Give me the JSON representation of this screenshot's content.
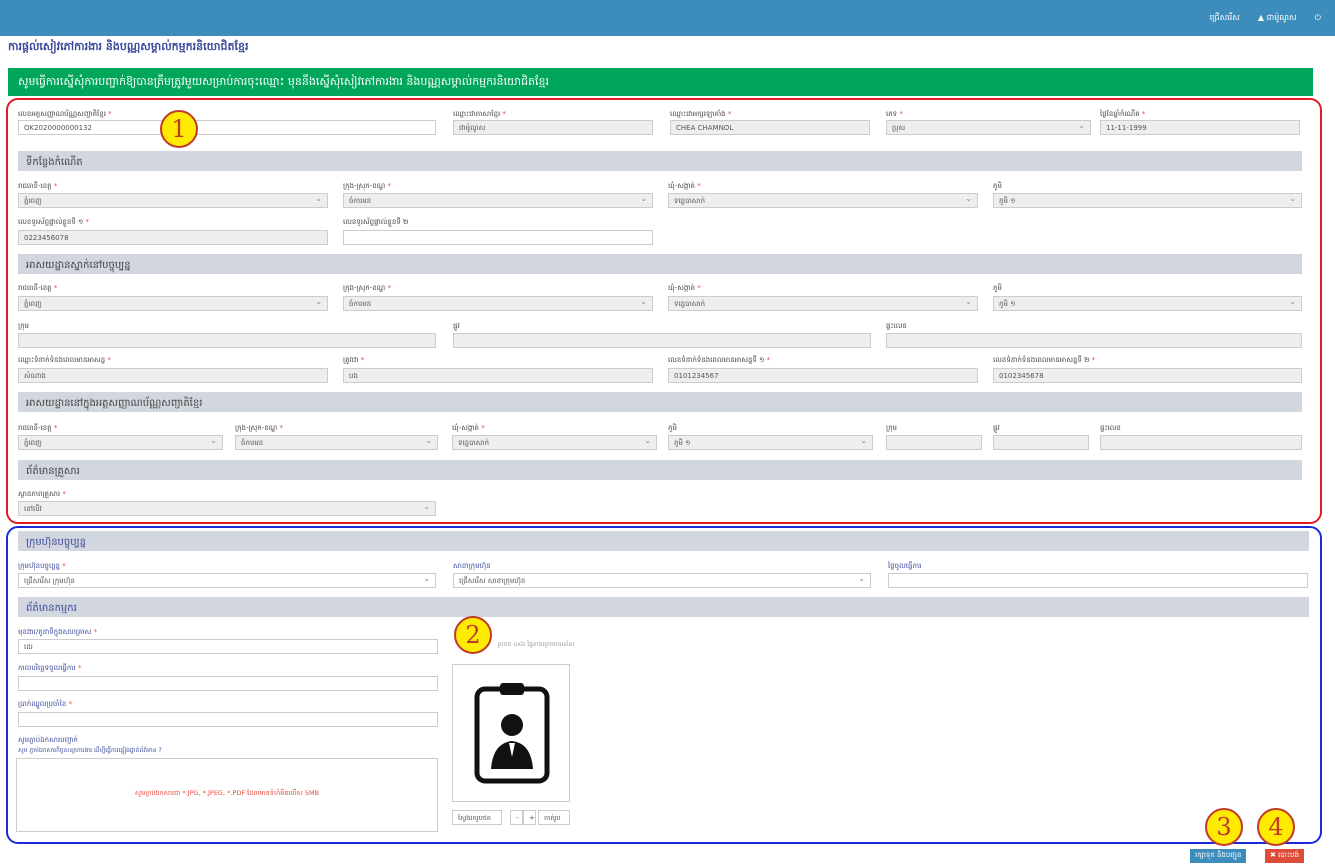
{
  "topbar": {
    "item1": "ជ្រើសរើស",
    "item2": "▲ ជាម៉ូណូស",
    "power": "⏻"
  },
  "page_title": "ការផ្ដល់សៀវភៅការងារ និងបណ្ណសម្គាល់កម្មករនិយោជិតខ្មែរ",
  "banner": "សូមធ្វើការស្នើសុំការបញ្ជាក់ឱ្យបានត្រឹមត្រូវមួយសម្រាប់ការចុះឈ្មោះ មុននឹងស្នើសុំសៀវភៅការងារ និងបណ្ណសម្គាល់កម្មករនិយោជិតខ្មែរ",
  "personal": {
    "id_label": "លេខអត្តសញ្ញាណប័ណ្ណសញ្ជាតិខ្មែរ",
    "id_value": "OK2020000000132",
    "name_kh_label": "ឈ្មោះជាភាសាខ្មែរ",
    "name_kh_value": "ជាម៉ូណូស",
    "name_en_label": "ឈ្មោះជាអក្សរឡាតាំង",
    "name_en_value": "CHEA CHAMNOL",
    "sex_label": "ភេទ",
    "sex_value": "ប្រុស",
    "dob_label": "ថ្ងៃខែឆ្នាំកំណើត",
    "dob_value": "11-11-1999"
  },
  "sections": {
    "birthplace": "ទីកន្លែងកំណើត",
    "current_address": "អាសយដ្ឋានស្នាក់នៅបច្ចុប្បន្ន",
    "id_address": "អាសយដ្ឋាននៅក្នុងអត្តសញ្ញាណប័ណ្ណសញ្ជាតិខ្មែរ",
    "family": "ព័ត៌មានគ្រួសារ",
    "employer": "ក្រុមហ៊ុនបច្ចុប្បន្ន",
    "worker_info": "ព័ត៌មានកម្មករ"
  },
  "labels": {
    "province": "រាជធានី-ខេត្ត",
    "district": "ក្រុង-ស្រុក-ខណ្ឌ",
    "commune": "ឃុំ-សង្កាត់",
    "village": "ភូមិ",
    "phone1": "លេខទូរស័ព្ទផ្ទាល់ខ្លួនទី ១",
    "phone2": "លេខទូរស័ព្ទផ្ទាល់ខ្លួនទី ២",
    "group": "ក្រុម",
    "street": "ផ្លូវ",
    "house": "ផ្ទះលេខ",
    "emergency_name": "ឈ្មោះទំនាក់ទំនងពេលមានអាសន្ន",
    "relation": "ត្រូវជា",
    "emergency_phone1": "លេខទំនាក់ទំនងពេលមានអាសន្នទី ១",
    "emergency_phone2": "លេខទំនាក់ទំនងពេលមានអាសន្នទី ២",
    "marital": "ស្ថានភាពគ្រួសារ",
    "company": "ក្រុមហ៊ុនបច្ចុប្បន្ន",
    "branch": "សាខាក្រុមហ៊ុន",
    "start_date": "ថ្ងៃចូលធ្វើការ",
    "position": "មុខងារ/តួនាទីក្នុងសហគ្រាស",
    "work_date": "កាលបរិច្ឆេទចូលធ្វើការ",
    "salary": "ប្រាក់ឈ្នួលប្រចាំខែ",
    "attach": "សូមភ្ជាប់ឯកសារបញ្ជាក់",
    "attach_note": "សូម ភ្ជាប់ឯកសារកិច្ចសន្យាការងារ ដើម្បីធ្វើការផ្ទៀងផ្ទាត់ព័ត៌មាន ?"
  },
  "values": {
    "province": "ភ្នំពេញ",
    "district": "ចំការមន",
    "commune": "ទន្លេបាសាក់",
    "village": "ភូមិ ១",
    "phone1": "0223456078",
    "emergency_name": "សំណាង",
    "relation": "បង",
    "emergency_phone1": "0101234567",
    "emergency_phone2": "0102345678",
    "marital": "នៅលីវ",
    "company_placeholder": "ជ្រើសរើស ក្រុមហ៊ុន",
    "branch_placeholder": "ជ្រើសរើស សាខាក្រុមហ៊ុន",
    "position": "ដេរ"
  },
  "photo": {
    "note": "រូបថត ៤x៦ ផ្ទៃខាងក្រោយពណ៌ស",
    "change_btn": "ស្វែងរករូបថត",
    "zoom_out": "-",
    "zoom_in": "+",
    "cut_btn": "កាត់រូប"
  },
  "upload_text": "សូមភ្ជាប់ឯកសារជា *.JPG, *.JPEG, *.PDF ដែលមានទំហំមិនលើស 5MB",
  "buttons": {
    "save": "រក្សាទុក និងបញ្ជូន",
    "cancel": "✖ បោះបង់"
  },
  "markers": [
    "1",
    "2",
    "3",
    "4"
  ],
  "colors": {
    "topbar": "#3c8dbc",
    "banner": "#00a65a",
    "save": "#3c8dbc",
    "cancel": "#dd4b39"
  }
}
